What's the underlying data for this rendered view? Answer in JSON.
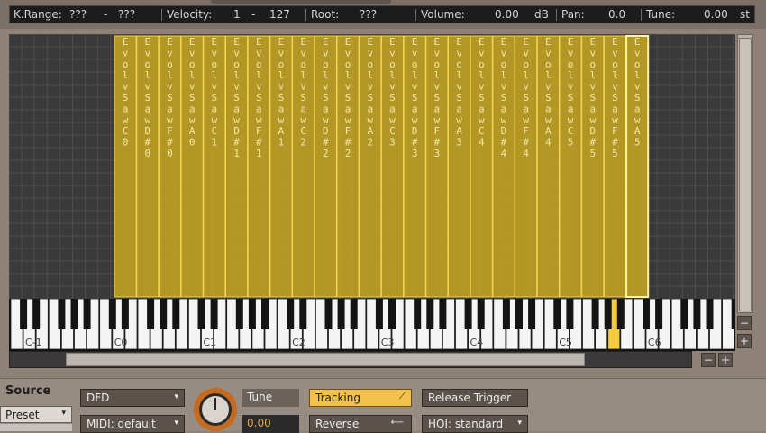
{
  "status": {
    "krange_label": "K.Range:",
    "krange_low": "???",
    "krange_dash": "-",
    "krange_high": "???",
    "velocity_label": "Velocity:",
    "velocity_low": "1",
    "velocity_dash": "-",
    "velocity_high": "127",
    "root_label": "Root:",
    "root_value": "???",
    "volume_label": "Volume:",
    "volume_value": "0.00",
    "volume_unit": "dB",
    "pan_label": "Pan:",
    "pan_value": "0.0",
    "tune_label": "Tune:",
    "tune_value": "0.00",
    "tune_unit": "st"
  },
  "zones": [
    {
      "name": "EvolvSaw",
      "note": "C0"
    },
    {
      "name": "EvolvSaw",
      "note": "D#0"
    },
    {
      "name": "EvolvSaw",
      "note": "F#0"
    },
    {
      "name": "EvolvSaw",
      "note": "A0"
    },
    {
      "name": "EvolvSaw",
      "note": "C1"
    },
    {
      "name": "EvolvSaw",
      "note": "D#1"
    },
    {
      "name": "EvolvSaw",
      "note": "F#1"
    },
    {
      "name": "EvolvSaw",
      "note": "A1"
    },
    {
      "name": "EvolvSaw",
      "note": "C2"
    },
    {
      "name": "EvolvSaw",
      "note": "D#2"
    },
    {
      "name": "EvolvSaw",
      "note": "F#2"
    },
    {
      "name": "EvolvSaw",
      "note": "A2"
    },
    {
      "name": "EvolvSaw",
      "note": "C3"
    },
    {
      "name": "EvolvSaw",
      "note": "D#3"
    },
    {
      "name": "EvolvSaw",
      "note": "F#3"
    },
    {
      "name": "EvolvSaw",
      "note": "A3"
    },
    {
      "name": "EvolvSaw",
      "note": "C4"
    },
    {
      "name": "EvolvSaw",
      "note": "D#4"
    },
    {
      "name": "EvolvSaw",
      "note": "F#4"
    },
    {
      "name": "EvolvSaw",
      "note": "A4"
    },
    {
      "name": "EvolvSaw",
      "note": "C5"
    },
    {
      "name": "EvolvSaw",
      "note": "D#5"
    },
    {
      "name": "EvolvSaw",
      "note": "F#5"
    },
    {
      "name": "EvolvSaw",
      "note": "A5"
    }
  ],
  "selected_zone_index": 23,
  "keyboard": {
    "octave_labels": [
      "C-1",
      "C0",
      "C1",
      "C2",
      "C3",
      "C4",
      "C5",
      "C6"
    ],
    "highlighted_key": "A5"
  },
  "zoom": {
    "minus": "−",
    "plus": "+"
  },
  "source": {
    "title": "Source",
    "preset_label": "Preset",
    "mode_select": "DFD",
    "midi_select": "MIDI: default",
    "tune_label": "Tune",
    "tune_value": "0.00",
    "tracking_label": "Tracking",
    "reverse_label": "Reverse",
    "release_trigger_label": "Release Trigger",
    "hqi_select": "HQI: standard"
  },
  "icons": {
    "dropdown_arrow": "▾",
    "tracking_icon": "⟋",
    "reverse_icon": "⟵"
  },
  "colors": {
    "zone_fill": "#c9a822",
    "zone_border": "#f4d44e",
    "zone_text": "#f4e7a6",
    "selected_border": "#fff3a0",
    "highlight_key": "#f2cc3a",
    "accent": "#f2c14a"
  }
}
